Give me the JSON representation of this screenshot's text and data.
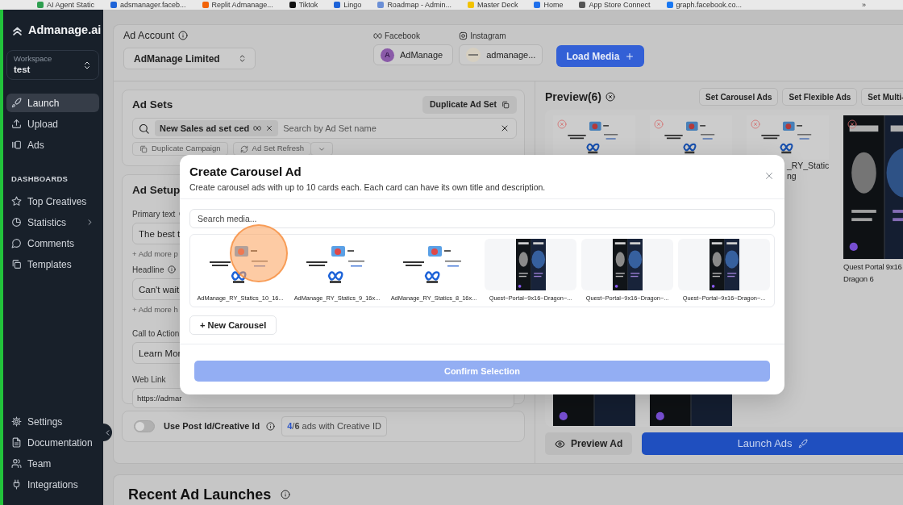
{
  "bookmarks": [
    {
      "label": "AI Agent Static",
      "color": "#2e9e4f"
    },
    {
      "label": "adsmanager.faceb...",
      "color": "#1d63d8"
    },
    {
      "label": "Replit Admanage...",
      "color": "#f26207"
    },
    {
      "label": "Tiktok",
      "color": "#111111"
    },
    {
      "label": "Lingo",
      "color": "#1d63d8"
    },
    {
      "label": "Roadmap - Admin...",
      "color": "#6b8fd6"
    },
    {
      "label": "Master Deck",
      "color": "#f2c200"
    },
    {
      "label": "Home",
      "color": "#1f6feb"
    },
    {
      "label": "App Store Connect",
      "color": "#555555"
    },
    {
      "label": "graph.facebook.co...",
      "color": "#1877f2"
    }
  ],
  "bookmarks_overflow": "»",
  "sidebar": {
    "brand": "Admanage.ai",
    "workspace": {
      "label": "Workspace",
      "value": "test"
    },
    "items": [
      {
        "label": "Launch",
        "selected": true
      },
      {
        "label": "Upload",
        "selected": false
      },
      {
        "label": "Ads",
        "selected": false
      }
    ],
    "section": "DASHBOARDS",
    "dashboard_items": [
      {
        "label": "Top Creatives",
        "selected": false,
        "has_submenu": false
      },
      {
        "label": "Statistics",
        "selected": false,
        "has_submenu": true
      },
      {
        "label": "Comments",
        "selected": false,
        "has_submenu": false
      },
      {
        "label": "Templates",
        "selected": false,
        "has_submenu": false
      }
    ],
    "footer_items": [
      {
        "label": "Settings",
        "selected": false
      },
      {
        "label": "Documentation",
        "selected": false
      },
      {
        "label": "Team",
        "selected": false
      },
      {
        "label": "Integrations",
        "selected": false
      }
    ]
  },
  "ad_account": {
    "label": "Ad Account",
    "value": "AdManage Limited"
  },
  "facebook": {
    "label": "Facebook",
    "avatar": "A",
    "page": "AdManage"
  },
  "instagram": {
    "label": "Instagram",
    "account": "admanage..."
  },
  "load_media": "Load Media",
  "ad_sets": {
    "title": "Ad Sets",
    "duplicate_button": "Duplicate Ad Set",
    "chip": "New Sales ad set ced",
    "search_placeholder": "Search by Ad Set name",
    "actions": [
      "Duplicate Campaign",
      "Ad Set Refresh"
    ]
  },
  "ad_setup": {
    "title": "Ad Setup",
    "fields": [
      {
        "label": "Primary text",
        "info": true,
        "value": "The best t",
        "add_more": "+ Add more p"
      },
      {
        "label": "Headline",
        "info": true,
        "value": "Can't wait",
        "add_more": "+ Add more h"
      },
      {
        "label": "Call to Action",
        "info": false,
        "value": "Learn Mor"
      },
      {
        "label": "Web Link",
        "info": false,
        "value": "https://admar"
      }
    ]
  },
  "post_id": {
    "label": "Use Post Id/Creative Id",
    "on": false,
    "badge": "**4**/**6** ads with Creative ID"
  },
  "preview": {
    "title": "Preview(6)",
    "buttons": [
      "Set Carousel Ads",
      "Set Flexible Ads",
      "Set Multi-"
    ],
    "cards": [
      {
        "kind": "static"
      },
      {
        "kind": "static"
      },
      {
        "kind": "static",
        "caption": [
          "_RY_Static",
          "ng"
        ]
      },
      {
        "kind": "portrait",
        "caption": [
          "Quest Portal 9x16",
          "Dragon 6"
        ]
      },
      {
        "kind": "portrait"
      },
      {
        "kind": "portrait"
      }
    ],
    "preview_button": "Preview Ad",
    "launch_button": "Launch Ads"
  },
  "recent": {
    "title": "Recent Ad Launches"
  },
  "modal": {
    "title": "Create Carousel Ad",
    "subtitle": "Create carousel ads with up to 10 cards each. Each card can have its own title and description.",
    "search_placeholder": "Search media...",
    "media": [
      {
        "kind": "static",
        "name": "AdManage_RY_Statics_10_16...",
        "highlighted": true
      },
      {
        "kind": "static",
        "name": "AdManage_RY_Statics_9_16x...",
        "highlighted": false
      },
      {
        "kind": "static",
        "name": "AdManage_RY_Statics_8_16x...",
        "highlighted": false
      },
      {
        "kind": "portrait",
        "name": "Quest~Portal~9x16~Dragon~...",
        "highlighted": false
      },
      {
        "kind": "portrait",
        "name": "Quest~Portal~9x16~Dragon~...",
        "highlighted": false
      },
      {
        "kind": "portrait",
        "name": "Quest~Portal~9x16~Dragon~...",
        "highlighted": false
      }
    ],
    "new_button": "+ New Carousel",
    "confirm_button": "Confirm Selection",
    "confirm_disabled": true
  }
}
